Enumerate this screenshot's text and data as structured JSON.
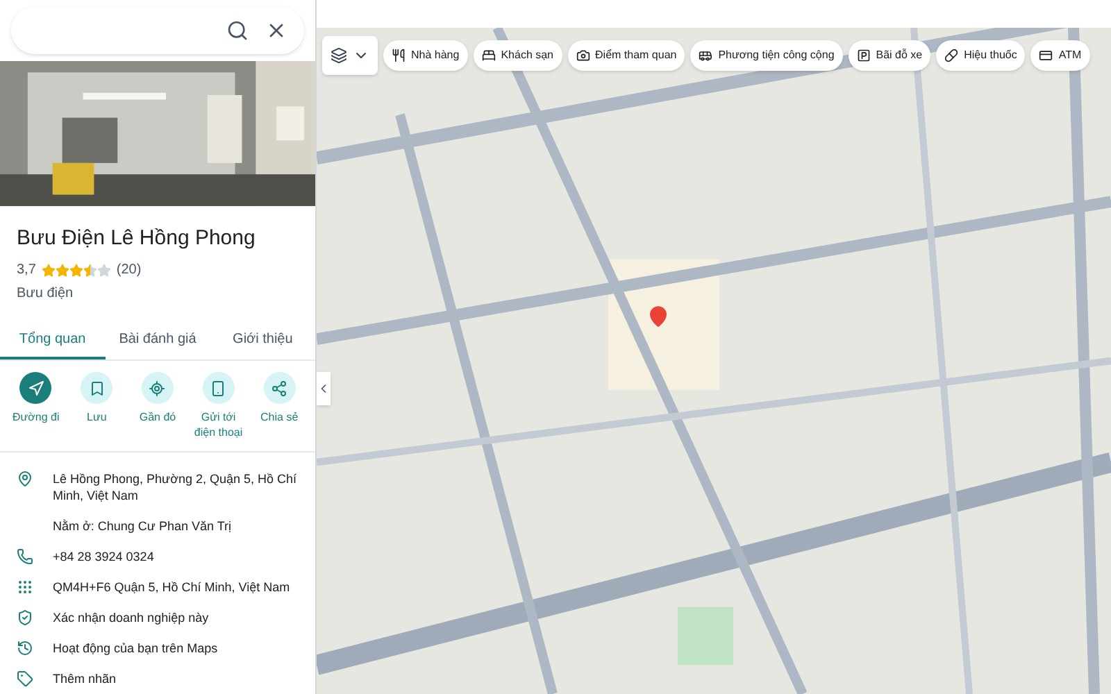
{
  "place": {
    "name": "Bưu Điện Lê Hồng Phong",
    "rating": "3,7",
    "stars": 3.5,
    "reviews": "(20)",
    "category": "Bưu điện"
  },
  "tabs": [
    {
      "label": "Tổng quan",
      "selected": true
    },
    {
      "label": "Bài đánh giá",
      "selected": false
    },
    {
      "label": "Giới thiệu",
      "selected": false
    }
  ],
  "actions": [
    {
      "label": "Đường đi",
      "kind": "directions"
    },
    {
      "label": "Lưu",
      "kind": "save"
    },
    {
      "label": "Gần đó",
      "kind": "nearby"
    },
    {
      "label": "Gửi tới điện thoại",
      "kind": "phone"
    },
    {
      "label": "Chia sẻ",
      "kind": "share"
    }
  ],
  "info": [
    {
      "text": "Lê Hồng Phong, Phường 2, Quận 5, Hồ Chí Minh, Việt Nam",
      "kind": "address"
    },
    {
      "text": "Nằm ở: Chung Cư Phan Văn Trị",
      "kind": "none"
    },
    {
      "text": "+84 28 3924 0324",
      "kind": "phone"
    },
    {
      "text": "QM4H+F6 Quận 5, Hồ Chí Minh, Việt Nam",
      "kind": "pluscode"
    },
    {
      "text": "Xác nhận doanh nghiệp này",
      "kind": "verify"
    },
    {
      "text": "Hoạt động của bạn trên Maps",
      "kind": "history"
    },
    {
      "text": "Thêm nhãn",
      "kind": "label"
    }
  ],
  "chips": [
    {
      "label": "Nhà hàng",
      "kind": "restaurant"
    },
    {
      "label": "Khách sạn",
      "kind": "hotel"
    },
    {
      "label": "Điểm tham quan",
      "kind": "camera"
    },
    {
      "label": "Phương tiện công cộng",
      "kind": "transit"
    },
    {
      "label": "Bãi đỗ xe",
      "kind": "parking"
    },
    {
      "label": "Hiệu thuốc",
      "kind": "pharmacy"
    },
    {
      "label": "ATM",
      "kind": "atm"
    }
  ]
}
